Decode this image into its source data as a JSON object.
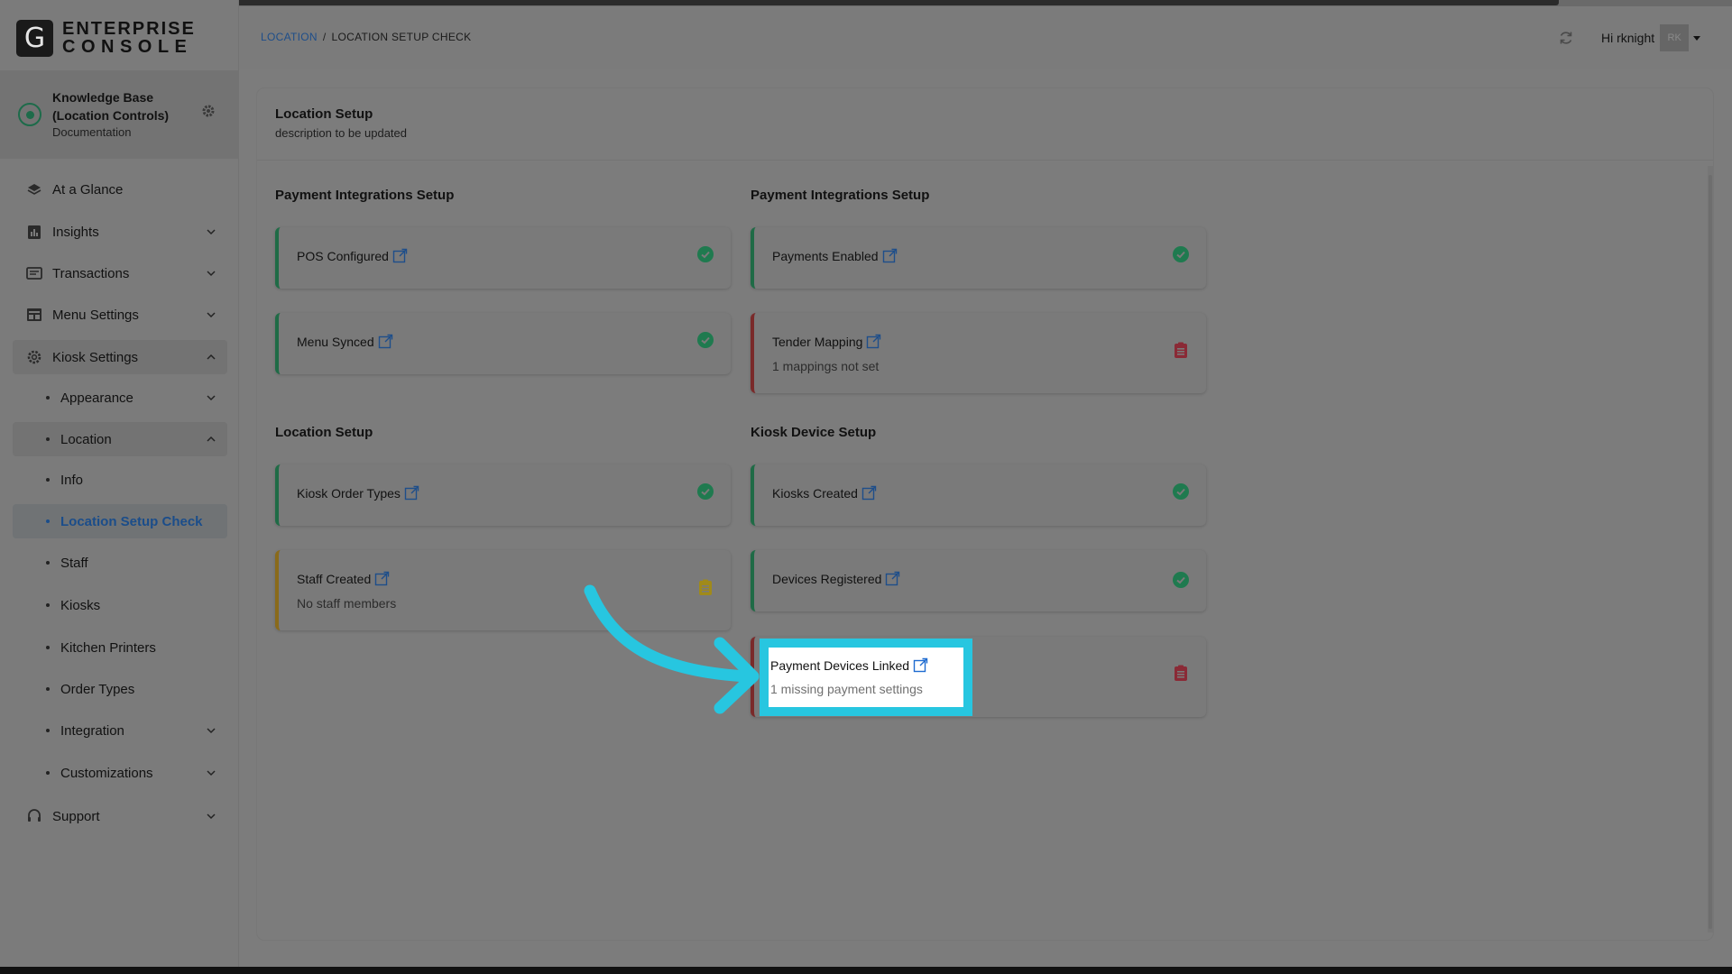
{
  "app": {
    "logo_letter": "G",
    "logo_line1": "ENTERPRISE",
    "logo_line2": "CONSOLE"
  },
  "knowledge_base": {
    "title": "Knowledge Base (Location Controls)",
    "subtitle": "Documentation"
  },
  "sidebar": {
    "items": [
      {
        "label": "At a Glance",
        "icon": "layers-icon"
      },
      {
        "label": "Insights",
        "icon": "insights-icon"
      },
      {
        "label": "Transactions",
        "icon": "transactions-icon"
      },
      {
        "label": "Menu Settings",
        "icon": "menu-settings-icon"
      },
      {
        "label": "Kiosk Settings",
        "icon": "gear-icon"
      },
      {
        "label": "Appearance"
      },
      {
        "label": "Location"
      },
      {
        "label": "Info"
      },
      {
        "label": "Location Setup Check"
      },
      {
        "label": "Staff"
      },
      {
        "label": "Kiosks"
      },
      {
        "label": "Kitchen Printers"
      },
      {
        "label": "Order Types"
      },
      {
        "label": "Integration"
      },
      {
        "label": "Customizations"
      },
      {
        "label": "Support",
        "icon": "headset-icon"
      }
    ]
  },
  "header": {
    "breadcrumb_link": "LOCATION",
    "breadcrumb_sep": "/",
    "breadcrumb_current": "LOCATION SETUP CHECK",
    "greeting": "Hi rknight",
    "avatar_initials": "RK"
  },
  "panel": {
    "title": "Location Setup",
    "description": "description to be updated"
  },
  "sections": {
    "left_top": "Payment Integrations Setup",
    "right_top": "Payment Integrations Setup",
    "left_bottom": "Location Setup",
    "right_bottom": "Kiosk Device Setup"
  },
  "cards": {
    "pos_configured": {
      "label": "POS Configured",
      "status": "ok"
    },
    "menu_synced": {
      "label": "Menu Synced",
      "status": "ok"
    },
    "payments_enabled": {
      "label": "Payments Enabled",
      "status": "ok"
    },
    "tender_mapping": {
      "label": "Tender Mapping",
      "message": "1 mappings not set",
      "status": "error"
    },
    "kiosk_order_types": {
      "label": "Kiosk Order Types",
      "status": "ok"
    },
    "staff_created": {
      "label": "Staff Created",
      "message": "No staff members",
      "status": "warning"
    },
    "kiosks_created": {
      "label": "Kiosks Created",
      "status": "ok"
    },
    "devices_registered": {
      "label": "Devices Registered",
      "status": "ok"
    },
    "payment_devices_linked": {
      "label": "Payment Devices Linked",
      "message": "1 missing payment settings",
      "status": "error"
    }
  },
  "colors": {
    "ok": "#1f7a4f",
    "warning": "#a08a1a",
    "error": "#8a2a36",
    "highlight": "#27c6e0",
    "link": "#1e4e8a"
  }
}
